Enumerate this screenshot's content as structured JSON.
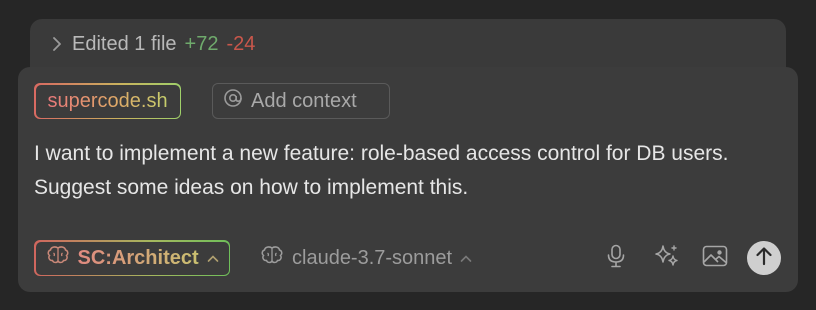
{
  "edited": {
    "label": "Edited 1 file",
    "additions": "+72",
    "deletions": "-24",
    "icon": "chevron-right-icon"
  },
  "composer": {
    "file_chip": "supercode.sh",
    "add_context": "Add context",
    "add_context_icon": "at-sign-icon",
    "message": "I want to implement a new feature: role-based access control for DB users. Suggest some ideas on how to implement this.",
    "mode": {
      "label": "SC:Architect",
      "icon": "brain-icon"
    },
    "model": {
      "label": "claude-3.7-sonnet",
      "icon": "brain-icon"
    },
    "tools": [
      "microphone-icon",
      "sparkles-icon",
      "image-icon",
      "send-arrow-icon"
    ]
  },
  "colors": {
    "background": "#262626",
    "panel": "#3c3c3c",
    "additions": "#6faa6c",
    "deletions": "#c9574b"
  }
}
